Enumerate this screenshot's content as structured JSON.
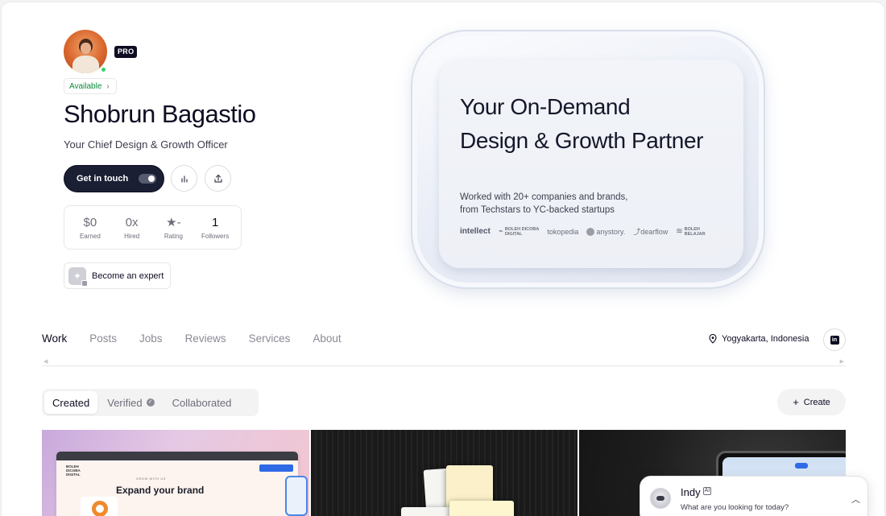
{
  "profile": {
    "badge": "PRO",
    "availability": "Available",
    "name": "Shobrun Bagastio",
    "tagline": "Your Chief Design & Growth Officer",
    "cta_label": "Get in touch"
  },
  "stats": [
    {
      "value": "$0",
      "label": "Earned"
    },
    {
      "value": "0x",
      "label": "Hired"
    },
    {
      "value": "★-",
      "label": "Rating"
    },
    {
      "value": "1",
      "label": "Followers"
    }
  ],
  "expert_label": "Become an expert",
  "hero": {
    "title_line1": "Your On-Demand",
    "title_line2": "Design & Growth Partner",
    "sub_line1": "Worked with 20+ companies and brands,",
    "sub_line2": "from Techstars to YC-backed startups",
    "logos": {
      "intellect": "intellect",
      "boleh_dicoba_1": "BOLEH DICOBA",
      "boleh_dicoba_2": "DIGITAL",
      "tokopedia": "tokopedia",
      "anystory": "anystory.",
      "dearflow": "dearflow",
      "boleh_belajar_1": "BOLEH",
      "boleh_belajar_2": "BELAJAR"
    }
  },
  "tabs": [
    "Work",
    "Posts",
    "Jobs",
    "Reviews",
    "Services",
    "About"
  ],
  "active_tab": "Work",
  "location": "Yogyakarta, Indonesia",
  "linkedin_glyph": "in",
  "filters": [
    "Created",
    "Verified",
    "Collaborated"
  ],
  "active_filter": "Created",
  "create_label": "Create",
  "thumbnail_1": {
    "nav_logo_1": "BOLEH DICOBA",
    "nav_logo_2": "DIGITAL",
    "kicker": "GROW WITH US",
    "headline": "Expand your brand"
  },
  "chat": {
    "name": "Indy",
    "ai_badge": "AI",
    "prompt": "What are you looking for today?"
  },
  "colors": {
    "accent_dark": "#1b1f34",
    "available_green": "#0b8a3a",
    "online_dot": "#3ccf6e"
  }
}
